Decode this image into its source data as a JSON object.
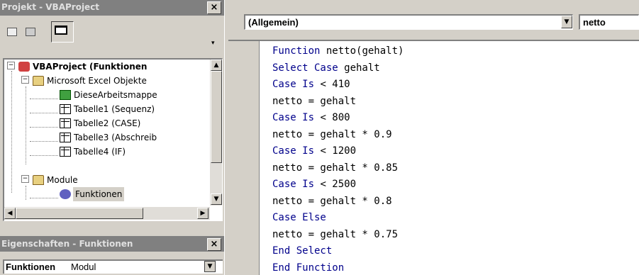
{
  "project_pane": {
    "title": "Projekt - VBAProject",
    "close": "×",
    "tree": [
      {
        "label": "VBAProject (Funktionen",
        "bold": true,
        "toggle": "−"
      },
      {
        "label": "Microsoft Excel Objekte",
        "toggle": "−"
      },
      {
        "label": "DieseArbeitsmappe"
      },
      {
        "label": "Tabelle1 (Sequenz)"
      },
      {
        "label": "Tabelle2 (CASE)"
      },
      {
        "label": "Tabelle3 (Abschreib"
      },
      {
        "label": "Tabelle4 (IF)"
      },
      {
        "label": "Module",
        "toggle": "−"
      },
      {
        "label": "Funktionen",
        "selected": true
      }
    ]
  },
  "properties_pane": {
    "title": "Eigenschaften - Funktionen",
    "close": "×",
    "object_name": "Funktionen",
    "object_type": "Modul"
  },
  "code_window": {
    "object_combo": "(Allgemein)",
    "procedure_combo": "netto",
    "lines": [
      {
        "kw": "Function",
        "rest": " netto(gehalt)"
      },
      {
        "kw": "Select Case",
        "rest": " gehalt"
      },
      {
        "kw": "Case Is",
        "rest": " < 410"
      },
      {
        "kw": "",
        "rest": "netto = gehalt"
      },
      {
        "kw": "Case Is",
        "rest": " < 800"
      },
      {
        "kw": "",
        "rest": "netto = gehalt * 0.9"
      },
      {
        "kw": "Case Is",
        "rest": " < 1200"
      },
      {
        "kw": "",
        "rest": "netto = gehalt * 0.85"
      },
      {
        "kw": "Case Is",
        "rest": " < 2500"
      },
      {
        "kw": "",
        "rest": "netto = gehalt * 0.8"
      },
      {
        "kw": "Case Else",
        "rest": ""
      },
      {
        "kw": "",
        "rest": "netto = gehalt * 0.75"
      },
      {
        "kw": "End Select",
        "rest": ""
      },
      {
        "kw": "End Function",
        "rest": ""
      }
    ],
    "keyword_color": "#00008b"
  }
}
